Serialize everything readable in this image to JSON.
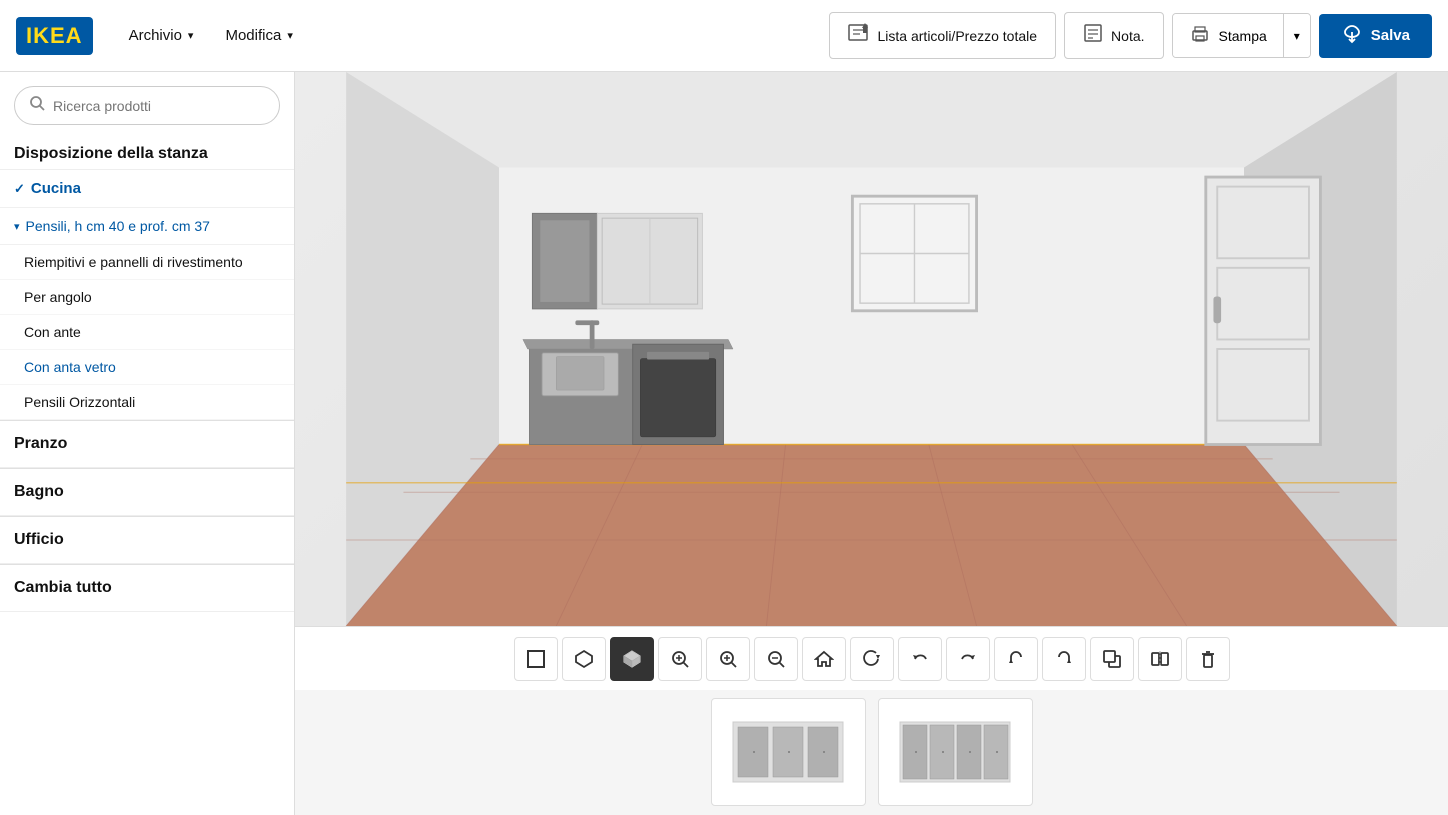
{
  "app": {
    "logo": "IKEA",
    "logo_color": "#0058a3",
    "logo_text_color": "#ffda1a"
  },
  "topnav": {
    "archivio_label": "Archivio",
    "modifica_label": "Modifica",
    "lista_btn": "Lista articoli/Prezzo totale",
    "nota_btn": "Nota.",
    "stampa_btn": "Stampa",
    "salva_btn": "Salva"
  },
  "sidebar": {
    "search_placeholder": "Ricerca prodotti",
    "room_layout_title": "Disposizione della stanza",
    "categories": [
      {
        "id": "cucina",
        "label": "Cucina",
        "active": true
      },
      {
        "id": "pranzo",
        "label": "Pranzo",
        "active": false
      },
      {
        "id": "bagno",
        "label": "Bagno",
        "active": false
      },
      {
        "id": "ufficio",
        "label": "Ufficio",
        "active": false
      },
      {
        "id": "cambia_tutto",
        "label": "Cambia tutto",
        "active": false
      }
    ],
    "subcategory": {
      "label": "Pensili, h cm 40 e prof. cm 37",
      "items": [
        {
          "id": "riempitivi",
          "label": "Riempitivi e pannelli di rivestimento",
          "active": false
        },
        {
          "id": "per_angolo",
          "label": "Per angolo",
          "active": false
        },
        {
          "id": "con_ante",
          "label": "Con ante",
          "active": false
        },
        {
          "id": "con_anta_vetro",
          "label": "Con anta vetro",
          "active": true
        },
        {
          "id": "pensili_orizzontali",
          "label": "Pensili Orizzontali",
          "active": false
        }
      ]
    }
  },
  "toolbar": {
    "buttons": [
      {
        "id": "2d-view",
        "icon": "□",
        "label": "Vista 2D"
      },
      {
        "id": "iso-view",
        "icon": "◇",
        "label": "Vista isometrica"
      },
      {
        "id": "3d-view",
        "icon": "⬡",
        "label": "Vista 3D",
        "active": true
      },
      {
        "id": "zoom-fit",
        "icon": "⊞",
        "label": "Zoom adatta"
      },
      {
        "id": "zoom-in",
        "icon": "🔍+",
        "label": "Zoom avanti"
      },
      {
        "id": "zoom-out",
        "icon": "🔍-",
        "label": "Zoom indietro"
      },
      {
        "id": "home",
        "icon": "⌂",
        "label": "Home"
      },
      {
        "id": "rotate-cw",
        "icon": "↻",
        "label": "Ruota orario"
      },
      {
        "id": "undo",
        "icon": "↩",
        "label": "Annulla"
      },
      {
        "id": "redo",
        "icon": "↪",
        "label": "Ripeti"
      },
      {
        "id": "rotate-left",
        "icon": "↰",
        "label": "Ruota sinistra"
      },
      {
        "id": "rotate-right",
        "icon": "↱",
        "label": "Ruota destra"
      },
      {
        "id": "copy",
        "icon": "❐",
        "label": "Copia"
      },
      {
        "id": "mirror",
        "icon": "⧈",
        "label": "Specchia"
      },
      {
        "id": "delete",
        "icon": "🗑",
        "label": "Elimina"
      }
    ]
  },
  "thumbnails": [
    {
      "id": "thumb1",
      "type": "cabinet-3door"
    },
    {
      "id": "thumb2",
      "type": "cabinet-4door"
    }
  ]
}
